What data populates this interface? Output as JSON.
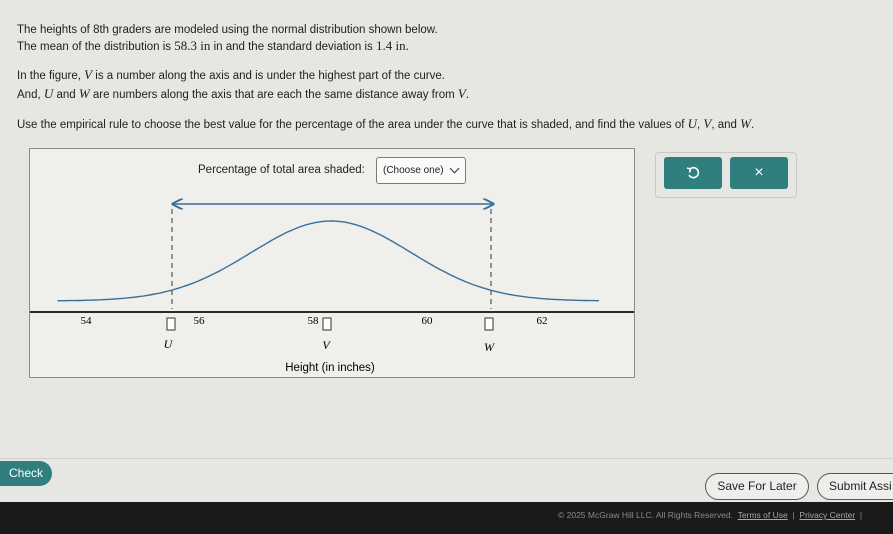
{
  "prompt": {
    "line1": "The heights of 8th graders are modeled using the normal distribution shown below.",
    "line2_a": "The mean of the distribution is ",
    "mean": "58.3",
    "line2_b": " in and the standard deviation is ",
    "sd": "1.4",
    "line2_c": " in.",
    "line3_a": "In the figure, ",
    "var_v": "V",
    "line3_b": " is a number along the axis and is under the highest part of the curve.",
    "line4_a": "And, ",
    "var_u": "U",
    "line4_b": " and ",
    "var_w": "W",
    "line4_c": " are numbers along the axis that are each the same distance away from ",
    "line4_d": ".",
    "line5_a": "Use the empirical rule to choose the best value for the percentage of the area under the curve that is shaded, and find the values of ",
    "line5_b": ", ",
    "line5_c": ", and ",
    "line5_d": "."
  },
  "units": {
    "in": "in"
  },
  "panel": {
    "shaded_label": "Percentage of total area shaded:",
    "dropdown_value": "(Choose one)"
  },
  "figure": {
    "xlabel": "Height (in inches)",
    "tick_labels": [
      "54",
      "56",
      "58",
      "60",
      "62"
    ],
    "var_labels": [
      "U",
      "V",
      "W"
    ]
  },
  "side_buttons": {
    "undo_icon": "undo-icon",
    "clear_glyph": "×"
  },
  "bottom": {
    "check": "Check",
    "save_for_later": "Save For Later",
    "submit": "Submit Assi"
  },
  "footer": {
    "copyright": "© 2025 McGraw Hill LLC. All Rights Reserved.",
    "terms": "Terms of Use",
    "sep": "|",
    "privacy": "Privacy Center",
    "sep2": "|"
  },
  "colors": {
    "accent": "#2f7f7f",
    "curve": "#3a6f9a",
    "arrow": "#3a6f9a"
  }
}
